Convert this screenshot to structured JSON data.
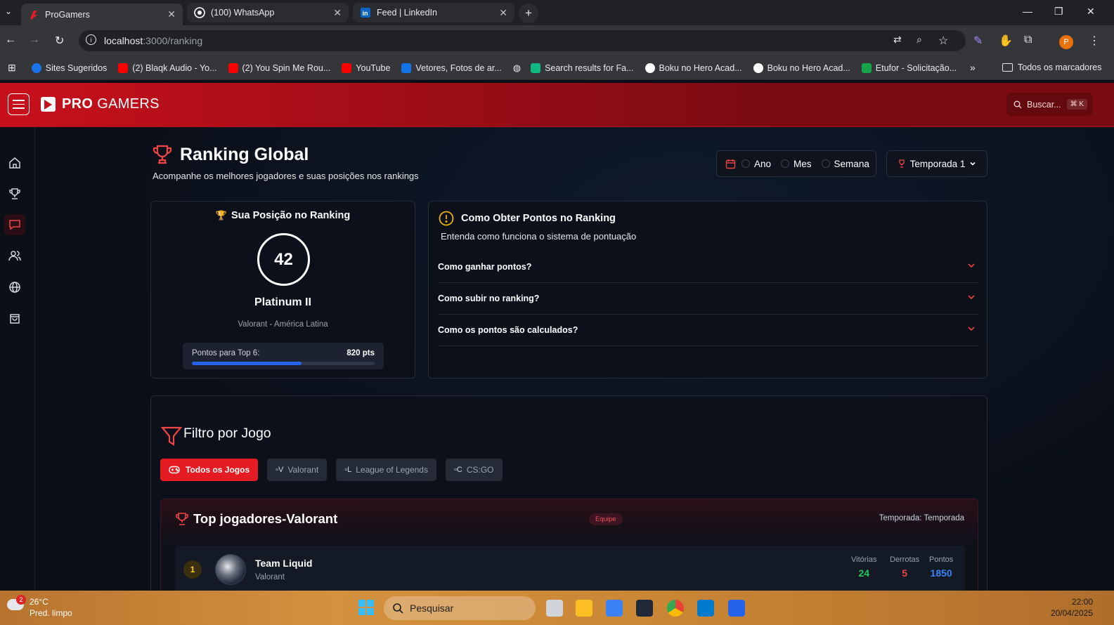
{
  "browser": {
    "tabs": [
      {
        "title": "ProGamers",
        "active": true
      },
      {
        "title": "(100) WhatsApp",
        "active": false
      },
      {
        "title": "Feed | LinkedIn",
        "active": false
      }
    ],
    "url_host": "localhost",
    "url_path": ":3000/ranking",
    "bookmarks": [
      "Sites Sugeridos",
      "(2) Blaqk Audio - Yo...",
      "(2) You Spin Me Rou...",
      "YouTube",
      "Vetores, Fotos de ar...",
      "Search results for Fa...",
      "Boku no Hero Acad...",
      "Boku no Hero Acad...",
      "Etufor - Solicitação..."
    ],
    "all_bookmarks": "Todos os marcadores",
    "profile_initial": "P"
  },
  "header": {
    "logo_bold": "PRO",
    "logo_rest": "GAMERS",
    "search_label": "Buscar...",
    "search_kbd": "⌘ K"
  },
  "page": {
    "title": "Ranking Global",
    "subtitle": "Acompanhe os melhores jogadores e suas posições nos rankings",
    "period_options": [
      "Ano",
      "Mes",
      "Semana"
    ],
    "season_select": "Temporada 1"
  },
  "rank_card": {
    "title": "Sua Posição no Ranking",
    "position": "42",
    "tier": "Platinum II",
    "game_region": "Valorant - América Latina",
    "progress_label": "Pontos para Top 6:",
    "progress_points": "820 pts",
    "progress_fraction": 0.6
  },
  "faq": {
    "title": "Como Obter Pontos no Ranking",
    "subtitle": "Entenda como funciona o sistema de pontuação",
    "items": [
      "Como ganhar pontos?",
      "Como subir no ranking?",
      "Como os pontos são calculados?"
    ]
  },
  "game_filter": {
    "title": "Filtro por Jogo",
    "buttons": [
      {
        "label": "Todos os Jogos",
        "alt": ""
      },
      {
        "label": "Valorant",
        "alt": "V"
      },
      {
        "label": "League of Legends",
        "alt": "L"
      },
      {
        "label": "CS:GO",
        "alt": "C"
      }
    ]
  },
  "top_players": {
    "title": "Top jogadores-Valorant",
    "badge": "Equipe",
    "season_label": "Temporada: Temporada",
    "stat_labels": [
      "Vitórias",
      "Derrotas",
      "Pontos"
    ],
    "rows": [
      {
        "position": "1",
        "name": "Team Liquid",
        "game": "Valorant",
        "wins": "24",
        "losses": "5",
        "points": "1850"
      }
    ]
  },
  "taskbar": {
    "temperature": "26°C",
    "weather": "Pred. limpo",
    "weather_badge": "2",
    "search_placeholder": "Pesquisar",
    "time": "22:00",
    "date": "20/04/2025"
  },
  "colors": {
    "brand_red": "#c8101c",
    "accent_red": "#e51b23",
    "progress_blue": "#2563eb",
    "wins_green": "#22c55e",
    "losses_red": "#ef4444",
    "points_blue": "#3b82f6"
  }
}
